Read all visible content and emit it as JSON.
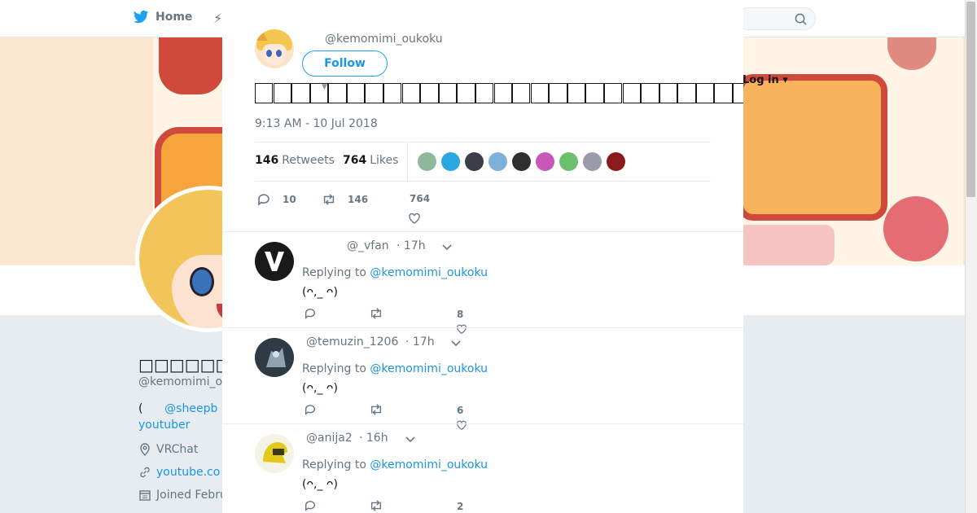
{
  "nav": {
    "home_label": "Home",
    "login_label": "Log in"
  },
  "profile": {
    "handle": "@kemomimi_o",
    "bio_paren": "(",
    "bio_link": "@sheepb",
    "bio_line2": "youtuber",
    "location": "VRChat",
    "website": "youtube.co",
    "joined": "Joined Febru"
  },
  "tweet": {
    "author_handle": "@kemomimi_oukoku",
    "follow_label": "Follow",
    "timestamp": "9:13 AM - 10 Jul 2018",
    "retweets_count": "146",
    "retweets_label": "Retweets",
    "likes_count": "764",
    "likes_label": "Likes",
    "replies_action": "10",
    "retweets_action": "146",
    "likes_action": "764"
  },
  "likers_colors": [
    "#8fb89a",
    "#2aa7de",
    "#3d3d4a",
    "#7fb0d8",
    "#2f2f2f",
    "#c957b8",
    "#6cbf6c",
    "#9a9aa8",
    "#8b1a1a"
  ],
  "replies": [
    {
      "handle": "@_vfan",
      "time": "· 17h",
      "replying_label": "Replying to",
      "replying_to": "@kemomimi_oukoku",
      "text": "(ᴖ,_ ᴖ)",
      "likes": "8"
    },
    {
      "handle": "@temuzin_1206",
      "time": "· 17h",
      "replying_label": "Replying to",
      "replying_to": "@kemomimi_oukoku",
      "text": "(ᴖ,_ ᴖ)",
      "likes": "6"
    },
    {
      "handle": "@anija2",
      "time": "· 16h",
      "replying_label": "Replying to",
      "replying_to": "@kemomimi_oukoku",
      "text": "(ᴖ,_ ᴖ)",
      "likes": "2"
    }
  ],
  "colors": {
    "accent": "#1da1f2",
    "link": "#1b95e0",
    "muted": "#66757f"
  }
}
